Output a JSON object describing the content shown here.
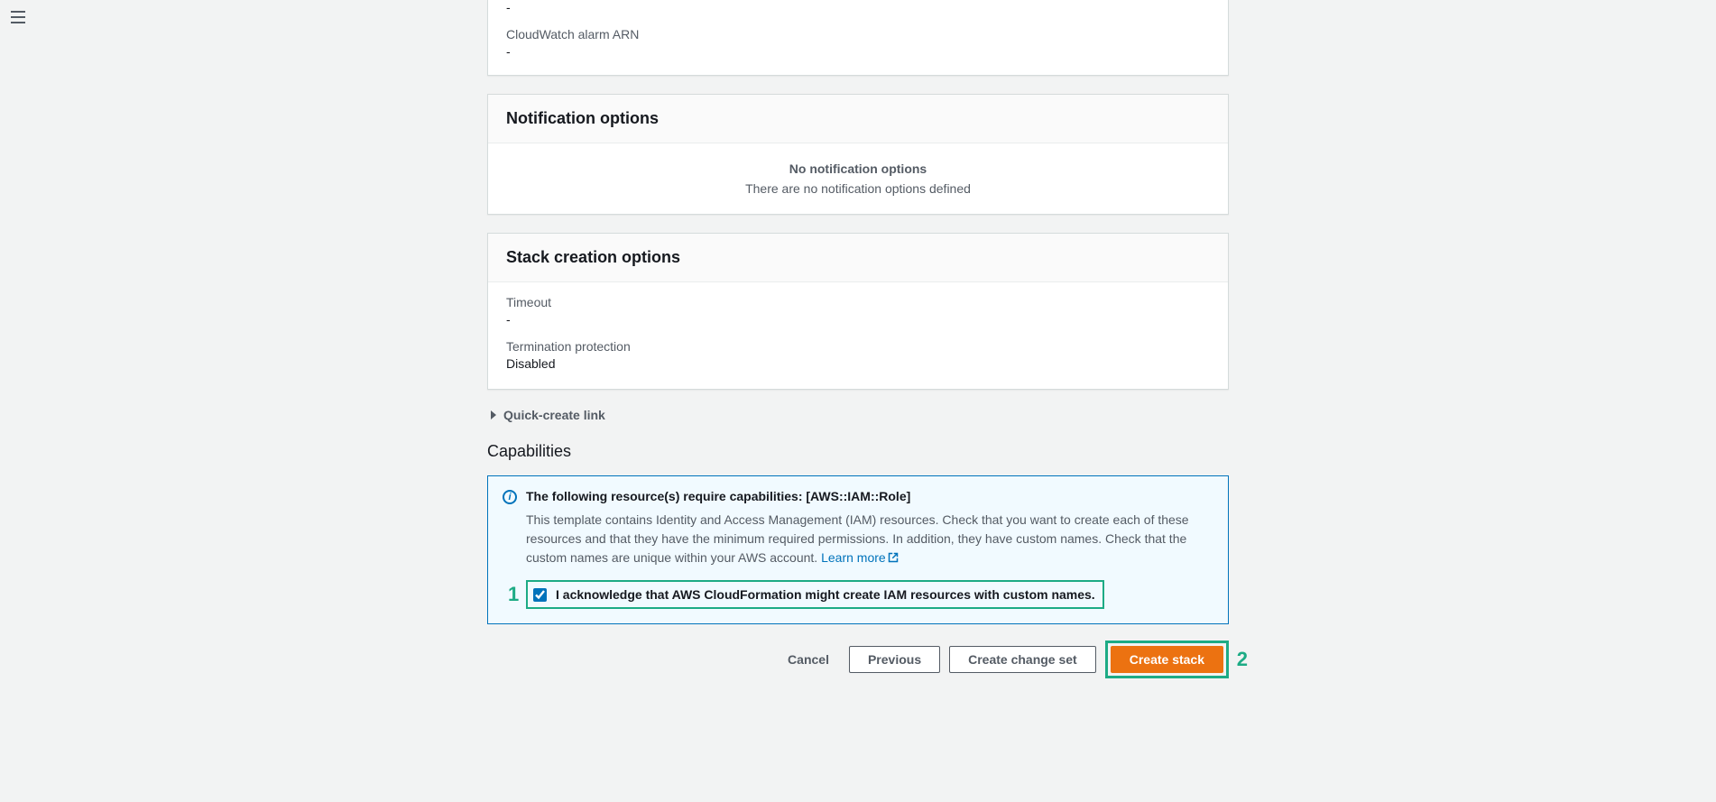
{
  "top_panel": {
    "value1": "-",
    "arn_label": "CloudWatch alarm ARN",
    "arn_value": "-"
  },
  "notification": {
    "title": "Notification options",
    "empty_title": "No notification options",
    "empty_desc": "There are no notification options defined"
  },
  "stack_creation": {
    "title": "Stack creation options",
    "timeout_label": "Timeout",
    "timeout_value": "-",
    "termination_label": "Termination protection",
    "termination_value": "Disabled"
  },
  "quick_create": "Quick-create link",
  "capabilities": {
    "heading": "Capabilities",
    "alert_title": "The following resource(s) require capabilities: [AWS::IAM::Role]",
    "alert_text": "This template contains Identity and Access Management (IAM) resources. Check that you want to create each of these resources and that they have the minimum required permissions. In addition, they have custom names. Check that the custom names are unique within your AWS account. ",
    "learn_more": "Learn more",
    "ack_label": "I acknowledge that AWS CloudFormation might create IAM resources with custom names."
  },
  "actions": {
    "cancel": "Cancel",
    "previous": "Previous",
    "change_set": "Create change set",
    "create_stack": "Create stack"
  },
  "annotations": {
    "one": "1",
    "two": "2"
  }
}
